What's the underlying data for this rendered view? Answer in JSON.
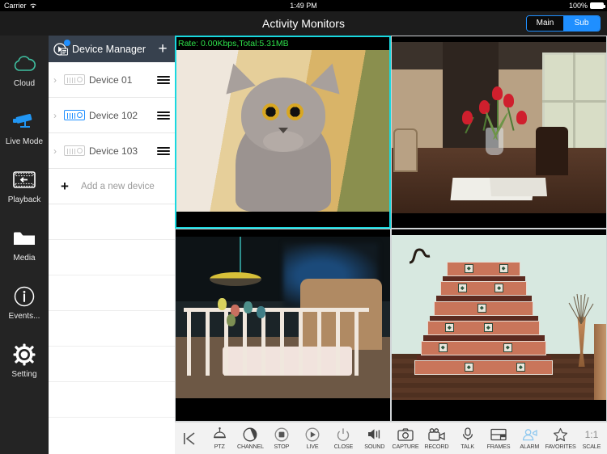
{
  "status_bar": {
    "carrier": "Carrier",
    "wifi_icon": "wifi-icon",
    "time": "1:49 PM",
    "battery_percent": "100%",
    "battery_icon": "battery-full-icon"
  },
  "nav_bar": {
    "title": "Activity Monitors",
    "segmented": {
      "options": [
        "Main",
        "Sub"
      ],
      "selected": "Sub",
      "accent_color": "#1f8fff"
    }
  },
  "sidebar": {
    "items": [
      {
        "label": "Cloud",
        "icon": "cloud-icon",
        "color": "#3fbfa0",
        "active": false
      },
      {
        "label": "Live Mode",
        "icon": "cctv-camera-icon",
        "color": "#2196f3",
        "active": true
      },
      {
        "label": "Playback",
        "icon": "film-rewind-icon",
        "color": "#ffffff",
        "active": false
      },
      {
        "label": "Media",
        "icon": "folder-icon",
        "color": "#ffffff",
        "active": false
      },
      {
        "label": "Events...",
        "icon": "info-circle-icon",
        "color": "#ffffff",
        "active": false
      },
      {
        "label": "Setting",
        "icon": "gear-icon",
        "color": "#ffffff",
        "active": false
      }
    ]
  },
  "device_panel": {
    "header": {
      "title": "Device Manager",
      "icon": "device-list-icon",
      "badge": true,
      "add_label": "+"
    },
    "devices": [
      {
        "name": "Device 01",
        "connected": false
      },
      {
        "name": "Device 102",
        "connected": true
      },
      {
        "name": "Device 103",
        "connected": false
      }
    ],
    "add_device": {
      "label": "Add a new device",
      "icon": "plus-icon"
    },
    "empty_rows": 6
  },
  "video_grid": {
    "cells": [
      {
        "position": "top-left",
        "selected": true,
        "overlay": "Rate: 0.00Kbps,Total:5.31MB",
        "overlay_color": "#2ee04a",
        "scene": "gray cat looking up, cream and yellow background"
      },
      {
        "position": "top-right",
        "selected": false,
        "overlay": "",
        "scene": "red tulips in vase on dining table with open book and eyeglasses"
      },
      {
        "position": "bottom-left",
        "selected": false,
        "overlay": "",
        "scene": "baby crib with hanging mobile"
      },
      {
        "position": "bottom-right",
        "selected": false,
        "overlay": "",
        "scene": "tiled brick staircase with patterned tiles and tall vase"
      }
    ],
    "selection_color": "#19d9e0"
  },
  "toolbar": {
    "back_icon": "skip-back-icon",
    "items": [
      {
        "label": "PTZ",
        "icon": "ptz-dome-icon",
        "highlight": false
      },
      {
        "label": "CHANNEL",
        "icon": "channel-circle-icon",
        "highlight": false
      },
      {
        "label": "STOP",
        "icon": "stop-icon",
        "highlight": false
      },
      {
        "label": "LIVE",
        "icon": "play-icon",
        "highlight": false
      },
      {
        "label": "CLOSE",
        "icon": "power-icon",
        "highlight": false
      },
      {
        "label": "SOUND",
        "icon": "speaker-icon",
        "highlight": false
      },
      {
        "label": "CAPTURE",
        "icon": "camera-icon",
        "highlight": false
      },
      {
        "label": "RECORD",
        "icon": "video-camera-icon",
        "highlight": false
      },
      {
        "label": "TALK",
        "icon": "microphone-icon",
        "highlight": false
      },
      {
        "label": "FRAMES",
        "icon": "frames-grid-icon",
        "highlight": false
      },
      {
        "label": "ALARM",
        "icon": "alarm-person-icon",
        "highlight": true
      },
      {
        "label": "FAVORITES",
        "icon": "star-icon",
        "highlight": false
      },
      {
        "label": "SCALE",
        "icon": "one-to-one-icon",
        "highlight": false
      }
    ],
    "scale_value": "1:1",
    "highlight_color": "#8ec8ef"
  }
}
